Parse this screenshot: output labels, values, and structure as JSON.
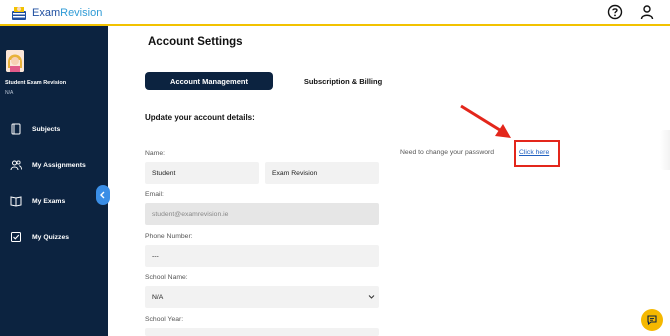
{
  "header": {
    "logo_main": "Exam",
    "logo_accent": "Revision",
    "help_icon": "question-circle-icon",
    "user_icon": "user-icon",
    "accent_color": "#f2c200"
  },
  "sidebar": {
    "user_name": "Student Exam Revision",
    "user_sub": "N/A",
    "items": [
      {
        "label": "Subjects",
        "icon": "book-icon"
      },
      {
        "label": "My Assignments",
        "icon": "users-icon"
      },
      {
        "label": "My Exams",
        "icon": "open-book-icon"
      },
      {
        "label": "My Quizzes",
        "icon": "checkbox-icon"
      }
    ],
    "bg_color": "#0c2340"
  },
  "main": {
    "title": "Account Settings",
    "tabs": [
      {
        "label": "Account Management",
        "active": true
      },
      {
        "label": "Subscription & Billing",
        "active": false
      }
    ],
    "section_heading": "Update your account details:",
    "fields": {
      "name_label": "Name:",
      "first_name": "Student",
      "last_name": "Exam Revision",
      "email_label": "Email:",
      "email_placeholder": "student@examrevision.ie",
      "phone_label": "Phone Number:",
      "phone_value": "---",
      "school_label": "School Name:",
      "school_value": "N/A",
      "year_label": "School Year:"
    },
    "password_prompt": "Need to change your password",
    "password_link": "Click here"
  }
}
